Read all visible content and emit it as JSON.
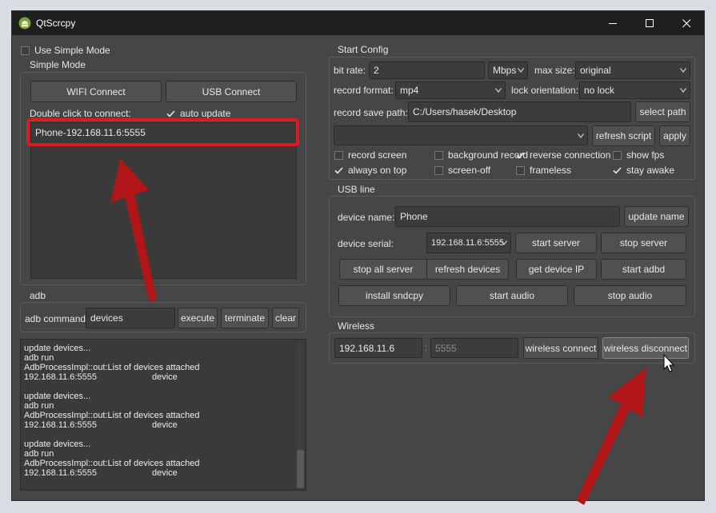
{
  "window": {
    "title": "QtScrcpy"
  },
  "simple": {
    "use_simple_mode": "Use Simple Mode",
    "use_simple_mode_checked": false,
    "group_title": "Simple Mode",
    "wifi_connect": "WIFI Connect",
    "usb_connect": "USB Connect",
    "double_click_label": "Double click to connect:",
    "auto_update": "auto update",
    "auto_update_checked": true,
    "devices": [
      "Phone-192.168.11.6:5555"
    ]
  },
  "adb": {
    "group_title": "adb",
    "command_label": "adb command:",
    "command_value": "devices",
    "execute": "execute",
    "terminate": "terminate",
    "clear": "clear",
    "log": [
      {
        "a": "update devices...",
        "b": ""
      },
      {
        "a": "adb run",
        "b": ""
      },
      {
        "a": "AdbProcessImpl::out:List of devices attached",
        "b": ""
      },
      {
        "a": "192.168.11.6:5555",
        "b": "device"
      },
      {
        "a": "",
        "b": ""
      },
      {
        "a": "update devices...",
        "b": ""
      },
      {
        "a": "adb run",
        "b": ""
      },
      {
        "a": "AdbProcessImpl::out:List of devices attached",
        "b": ""
      },
      {
        "a": "192.168.11.6:5555",
        "b": "device"
      },
      {
        "a": "",
        "b": ""
      },
      {
        "a": "update devices...",
        "b": ""
      },
      {
        "a": "adb run",
        "b": ""
      },
      {
        "a": "AdbProcessImpl::out:List of devices attached",
        "b": ""
      },
      {
        "a": "192.168.11.6:5555",
        "b": "device"
      }
    ]
  },
  "start_config": {
    "group_title": "Start Config",
    "bit_rate_label": "bit rate:",
    "bit_rate_value": "2",
    "bit_rate_unit": "Mbps",
    "max_size_label": "max size:",
    "max_size_value": "original",
    "record_format_label": "record format:",
    "record_format_value": "mp4",
    "lock_orientation_label": "lock orientation:",
    "lock_orientation_value": "no lock",
    "record_save_path_label": "record save path:",
    "record_save_path_value": "C:/Users/hasek/Desktop",
    "select_path": "select path",
    "script_value": "",
    "refresh_script": "refresh script",
    "apply": "apply",
    "options": [
      {
        "label": "record screen",
        "checked": false
      },
      {
        "label": "background record",
        "checked": false
      },
      {
        "label": "reverse connection",
        "checked": true
      },
      {
        "label": "show fps",
        "checked": false
      },
      {
        "label": "always on top",
        "checked": true
      },
      {
        "label": "screen-off",
        "checked": false
      },
      {
        "label": "frameless",
        "checked": false
      },
      {
        "label": "stay awake",
        "checked": true
      }
    ]
  },
  "usb_line": {
    "group_title": "USB line",
    "device_name_label": "device name:",
    "device_name_value": "Phone",
    "update_name": "update name",
    "device_serial_label": "device serial:",
    "device_serial_value": "192.168.11.6:5555",
    "start_server": "start server",
    "stop_server": "stop server",
    "stop_all_server": "stop all server",
    "refresh_devices": "refresh devices",
    "get_device_ip": "get device IP",
    "start_adbd": "start adbd",
    "install_sndcpy": "install sndcpy",
    "start_audio": "start audio",
    "stop_audio": "stop audio"
  },
  "wireless": {
    "group_title": "Wireless",
    "ip_value": "192.168.11.6",
    "separator": ":",
    "port_placeholder": "5555",
    "wireless_connect": "wireless connect",
    "wireless_disconnect": "wireless disconnect"
  },
  "colors": {
    "annotation_red": "#d81e22",
    "arrow_red": "#b01518",
    "window_bg": "#464646",
    "titlebar_bg": "#1f1f1f"
  }
}
